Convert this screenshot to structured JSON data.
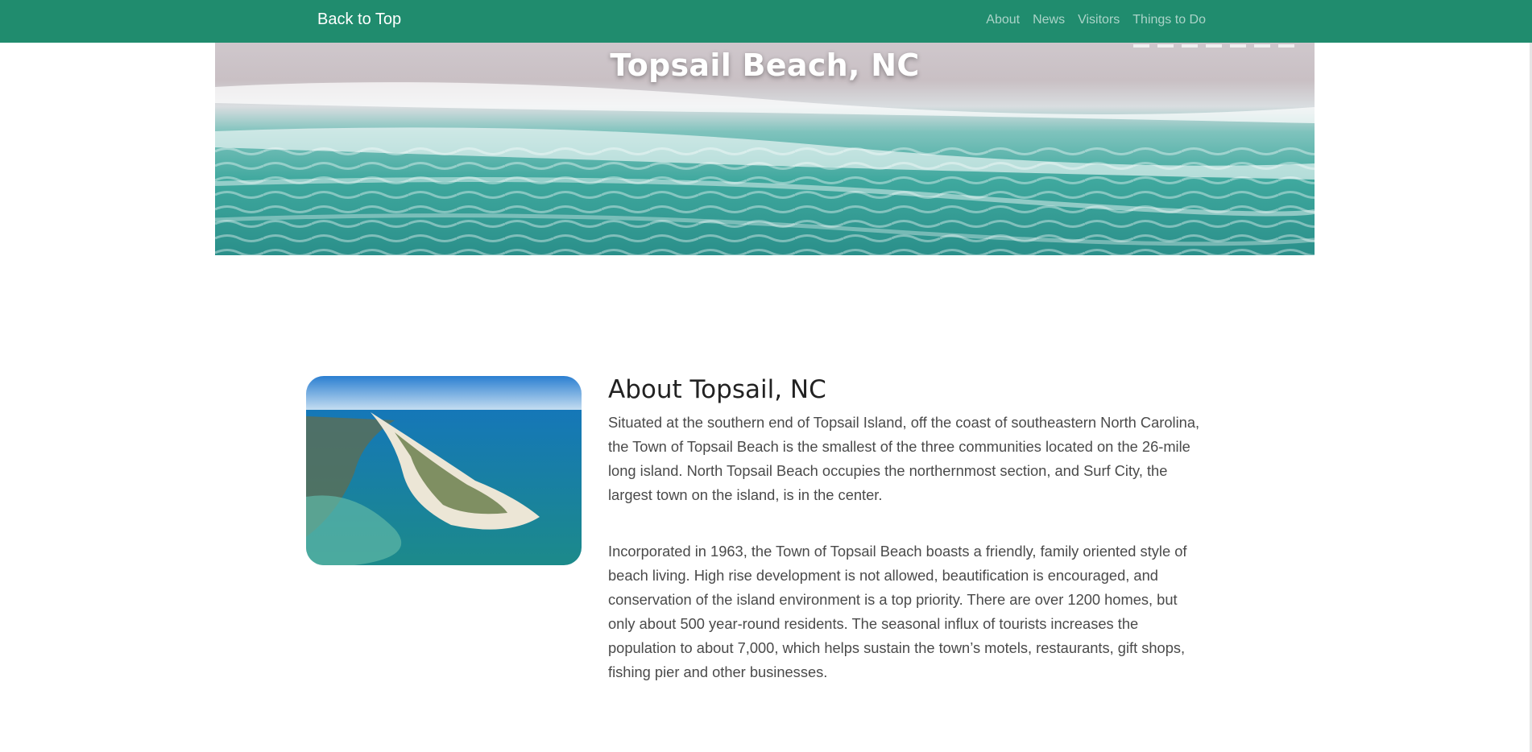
{
  "navbar": {
    "brand": "Back to Top",
    "links": [
      "About",
      "News",
      "Visitors",
      "Things to Do"
    ]
  },
  "hero": {
    "title": "Topsail Beach, NC"
  },
  "about": {
    "title": "About Topsail, NC",
    "paragraphs": [
      "Situated at the southern end of Topsail Island, off the coast of southeastern North Carolina, the Town of Topsail Beach is the smallest of the three communities located on the 26-mile long island. North Topsail Beach occupies the northernmost section, and Surf City, the largest town on the island, is in the center.",
      "Incorporated in 1963, the Town of Topsail Beach boasts a friendly, family oriented style of beach living. High rise development is not allowed, beautification is encouraged, and conservation of the island environment is a top priority. There are over 1200 homes, but only about 500 year-round residents. The seasonal influx of tourists increases the population to about 7,000, which helps sustain the town’s motels, restaurants, gift shops, fishing pier and other businesses."
    ]
  },
  "colors": {
    "navbar_bg": "#208c6e",
    "brand_text": "#ffffff",
    "nav_link_text": "rgba(255,255,255,0.62)"
  }
}
